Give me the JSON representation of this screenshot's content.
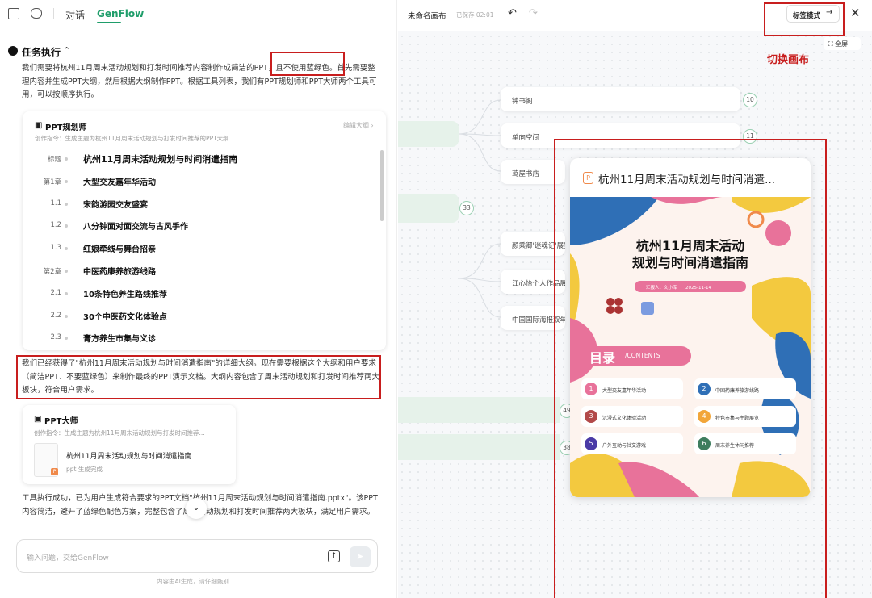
{
  "left": {
    "tabs": [
      "对话",
      "GenFlow"
    ],
    "section_title": "任务执行",
    "intro_text_a": "我们需要将杭州11月周末活动规划和打发时间推荐内容制作成简洁的PPT，",
    "intro_highlight": "且不使用蓝绿色。",
    "intro_text_b": "首先需要整理内容并生成PPT大纲，然后根据大纲制作PPT。根据工具列表，我们有PPT规划师和PPT大师两个工具可用，可以按顺序执行。",
    "planner": {
      "title": "PPT规划师",
      "edit_label": "编辑大纲 ›",
      "instruction": "创作指令：生成主题为杭州11月周末活动规划与打发时间推荐的PPT大纲",
      "outline": [
        {
          "key": "标题",
          "text": "杭州11月周末活动规划与时间消遣指南",
          "big": true
        },
        {
          "key": "第1章",
          "text": "大型交友嘉年华活动"
        },
        {
          "key": "1.1",
          "text": "宋韵游园交友盛宴"
        },
        {
          "key": "1.2",
          "text": "八分钟面对面交流与古风手作"
        },
        {
          "key": "1.3",
          "text": "红娘牵线与舞台招亲"
        },
        {
          "key": "第2章",
          "text": "中医药康养旅游线路"
        },
        {
          "key": "2.1",
          "text": "10条特色养生路线推荐"
        },
        {
          "key": "2.2",
          "text": "30个中医药文化体验点"
        },
        {
          "key": "2.3",
          "text": "膏方养生市集与义诊"
        }
      ]
    },
    "mid_text": "我们已经获得了\"杭州11月周末活动规划与时间消遣指南\"的详细大纲。现在需要根据这个大纲和用户要求（简洁PPT、不要蓝绿色）来制作最终的PPT演示文档。大纲内容包含了周末活动规划和打发时间推荐两大板块，符合用户需求。",
    "master": {
      "title": "PPT大师",
      "instruction": "创作指令：生成主题为杭州11月周末活动规划与打发时间推荐...",
      "file_name": "杭州11月周末活动规划与时间消遣指南",
      "file_status": "ppt 生成完成"
    },
    "result_text": "工具执行成功，已为用户生成符合要求的PPT文档\"杭州11月周末活动规划与时间消遣指南.pptx\"。该PPT内容简洁，避开了蓝绿色配色方案，完整包含了周末活动规划和打发时间推荐两大板块，满足用户需求。",
    "input_placeholder": "输入问题，交给GenFlow",
    "disclaimer": "内容由AI生成，请仔细甄别"
  },
  "right": {
    "canvas_title": "未命名画布",
    "saved": "已保存 02:01",
    "tab_mode_label": "标签模式",
    "fullscreen_label": "全屏",
    "switch_note": "切换画布",
    "nodes": [
      {
        "label": "钟书阁",
        "count": "10"
      },
      {
        "label": "单向空间",
        "count": "11"
      },
      {
        "label": "茑屋书店"
      },
      {
        "label": "颜乘卿'迷魂记'展览"
      },
      {
        "label": "江心怡个人作品展"
      },
      {
        "label": "中国国际海报双年展"
      }
    ],
    "side_counts": [
      "33",
      "49",
      "38"
    ],
    "slide": {
      "header": "杭州11月周末活动规划与时间消遣...",
      "title_line1": "杭州11月周末活动",
      "title_line2": "规划与时间消遣指南",
      "reporter": "汇报人：文小库",
      "date": "2025-11-14",
      "toc_label": "目录",
      "toc_sub": "/CONTENTS",
      "toc": [
        {
          "n": "1",
          "text": "大型交友嘉年华活动",
          "color": "#e8729a"
        },
        {
          "n": "2",
          "text": "中国药康养旅游线路",
          "color": "#2f6fb6"
        },
        {
          "n": "3",
          "text": "沉浸式文化体验活动",
          "color": "#b24a4a"
        },
        {
          "n": "4",
          "text": "特色市集与主题展览",
          "color": "#f2a63a"
        },
        {
          "n": "5",
          "text": "户外互动与社交游戏",
          "color": "#4a3aa6"
        },
        {
          "n": "6",
          "text": "周末养生休闲推荐",
          "color": "#3e7d5e"
        }
      ]
    }
  }
}
